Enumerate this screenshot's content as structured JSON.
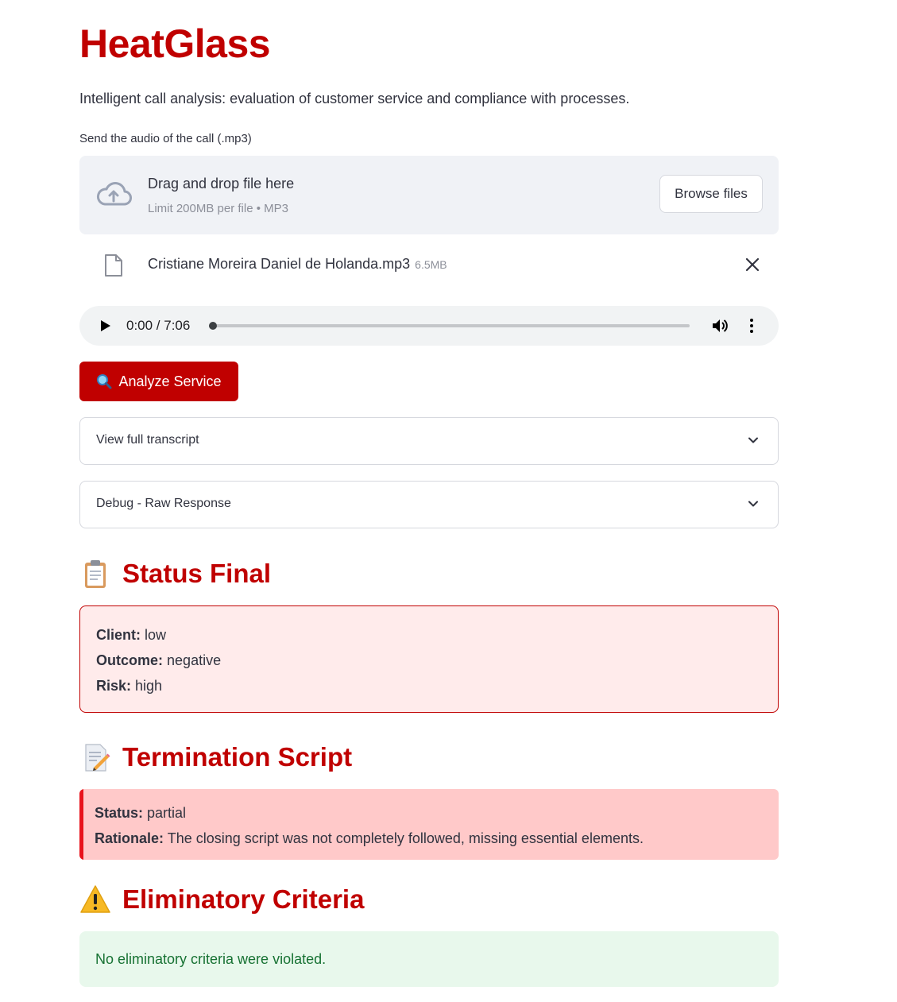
{
  "app": {
    "title": "HeatGlass",
    "subtitle": "Intelligent call analysis: evaluation of customer service and compliance with processes."
  },
  "uploader": {
    "label": "Send the audio of the call (.mp3)",
    "drop_title": "Drag and drop file here",
    "drop_limit": "Limit 200MB per file • MP3",
    "browse_label": "Browse files",
    "file": {
      "name": "Cristiane Moreira Daniel de Holanda.mp3",
      "size": "6.5MB"
    }
  },
  "audio": {
    "time": "0:00 / 7:06",
    "progress": 0.0
  },
  "actions": {
    "analyze_label": "Analyze Service"
  },
  "expanders": [
    {
      "label": "View full transcript"
    },
    {
      "label": "Debug - Raw Response"
    }
  ],
  "status_final": {
    "heading": "Status Final",
    "icon": "clipboard-icon",
    "items": [
      {
        "key": "Client:",
        "value": "low"
      },
      {
        "key": "Outcome:",
        "value": "negative"
      },
      {
        "key": "Risk:",
        "value": "high"
      }
    ]
  },
  "termination_script": {
    "heading": "Termination Script",
    "icon": "memo-icon",
    "items": [
      {
        "key": "Status:",
        "value": "partial"
      },
      {
        "key": "Rationale:",
        "value": "The closing script was not completely followed, missing essential elements."
      }
    ]
  },
  "eliminatory": {
    "heading": "Eliminatory Criteria",
    "icon": "warning-icon",
    "message": "No eliminatory criteria were violated."
  },
  "colors": {
    "brand": "#c00000",
    "error_bg": "#ffebeb",
    "alert_bg": "#ffc9c9",
    "alert_bar": "#e8131c",
    "success_bg": "#e8f8ec",
    "success_text": "#177233"
  }
}
